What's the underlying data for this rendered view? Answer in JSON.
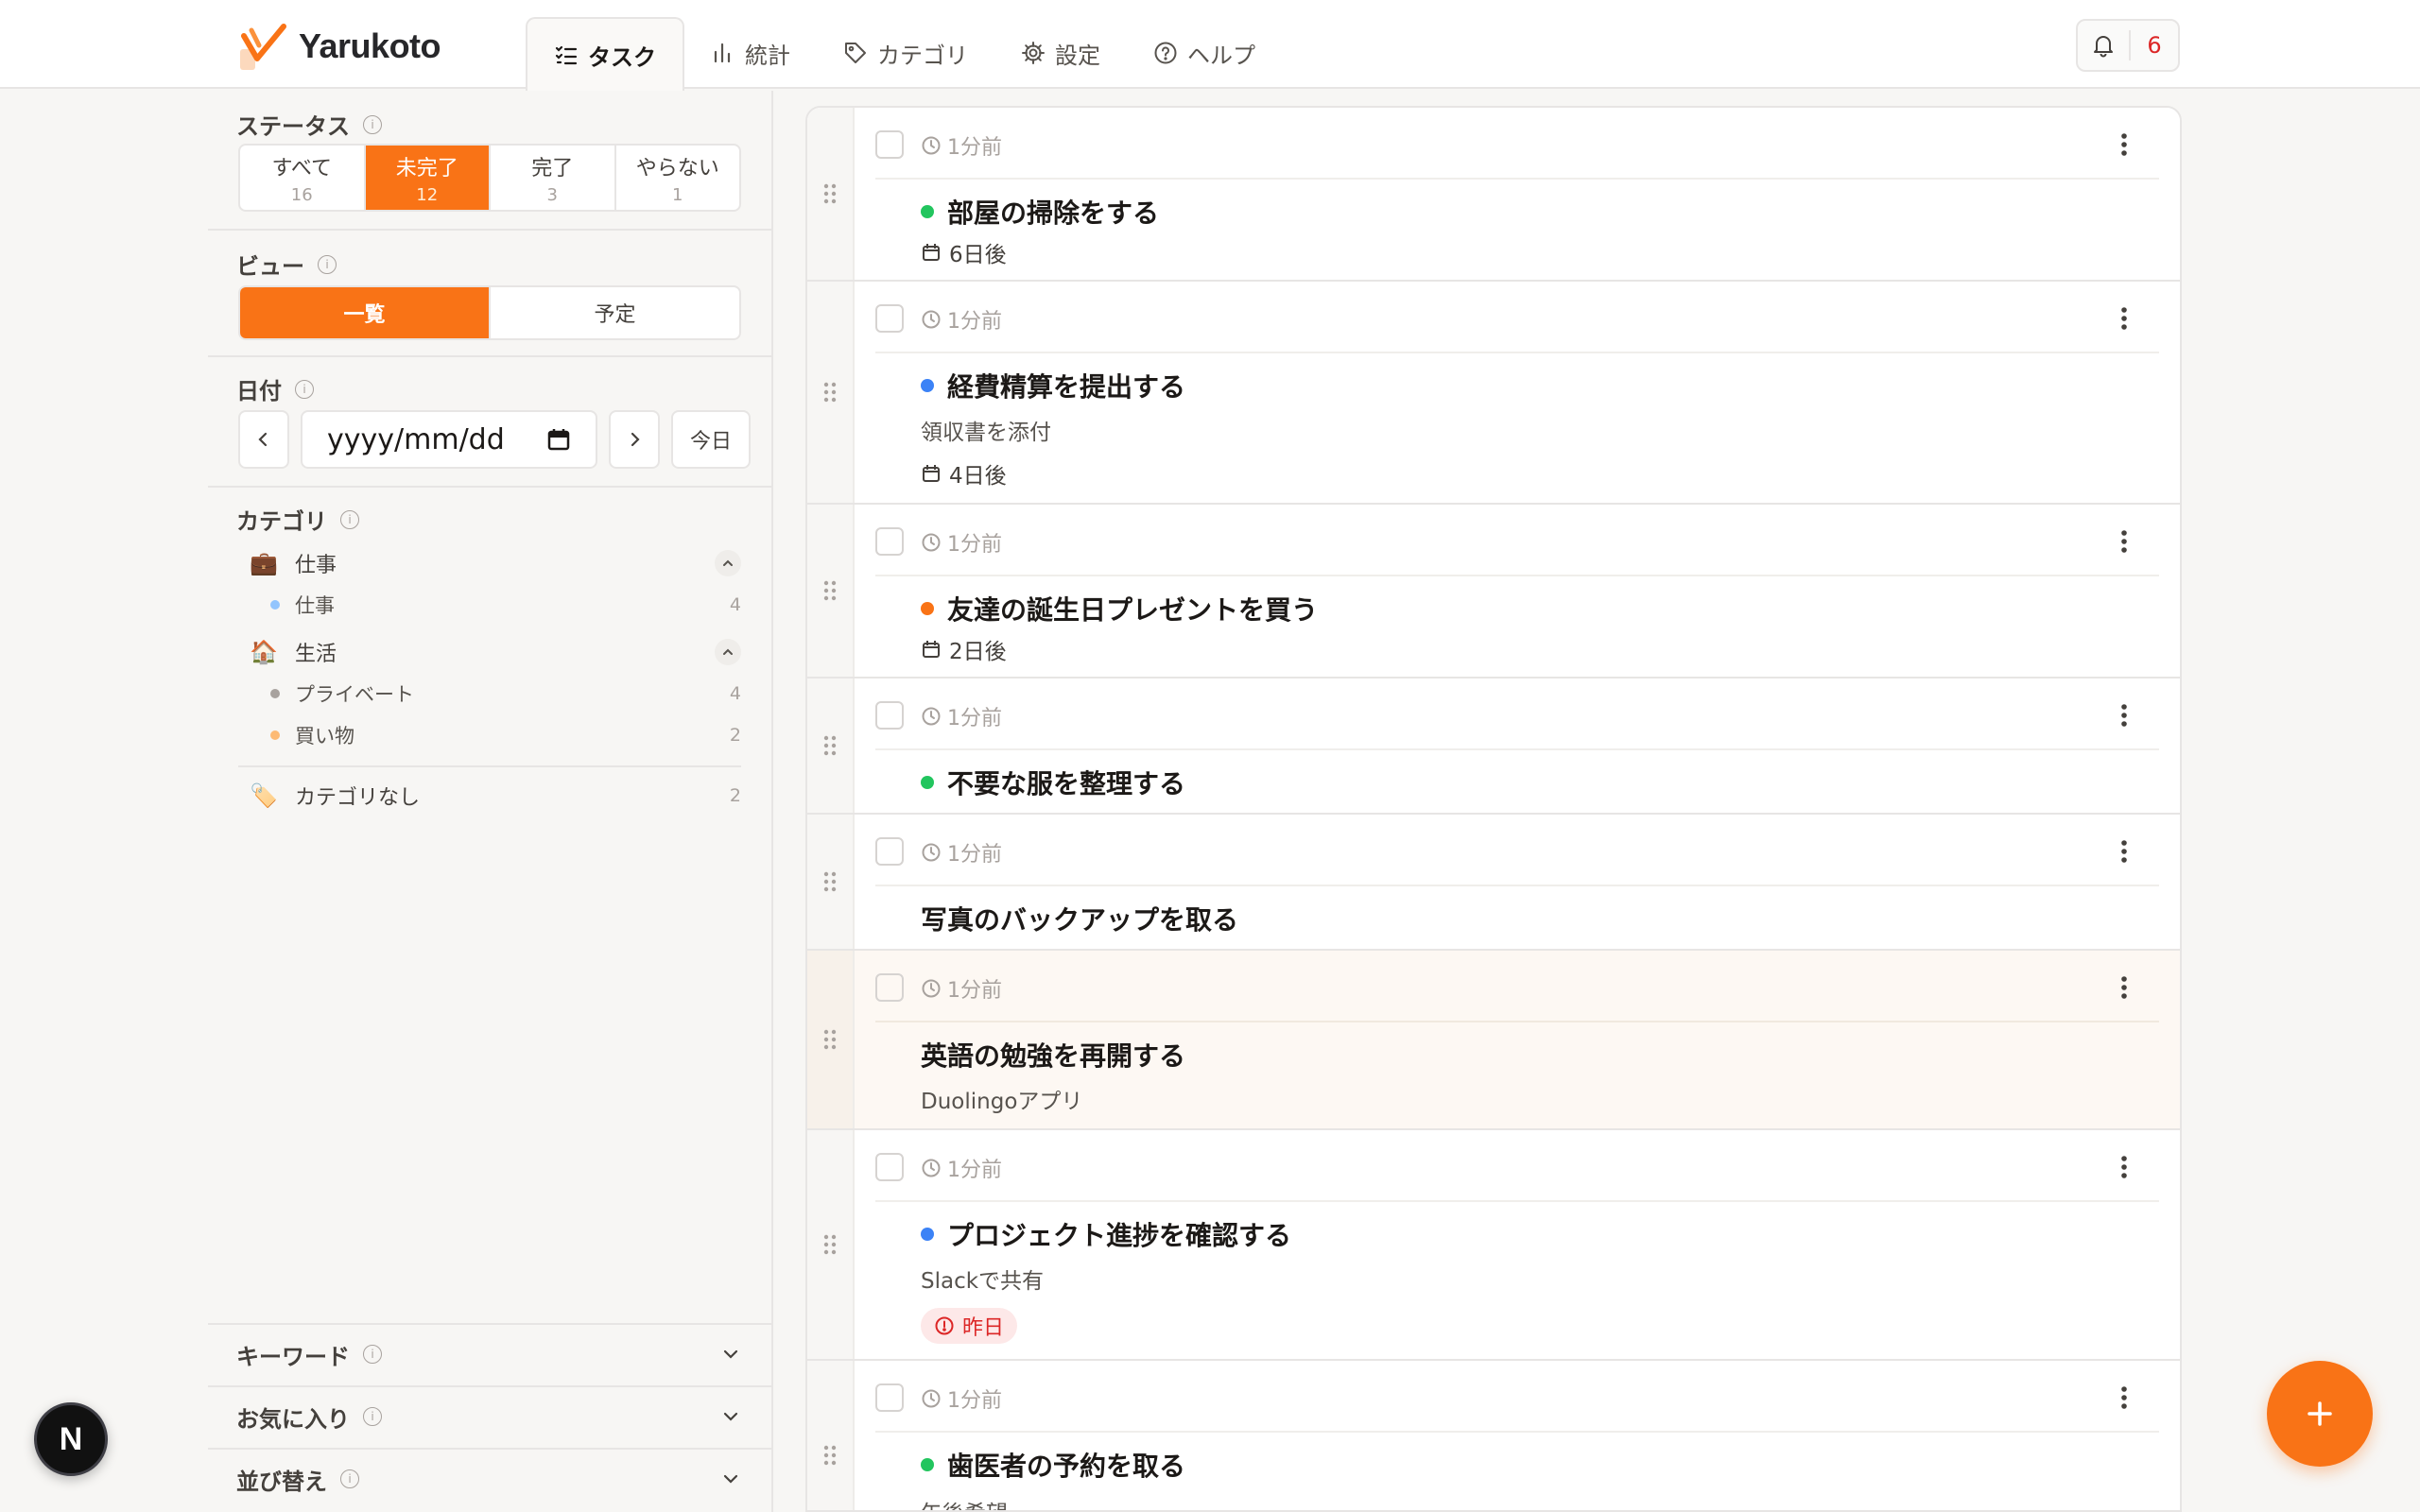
{
  "app": {
    "name": "Yarukoto"
  },
  "nav": {
    "tabs": [
      {
        "label": "タスク",
        "icon": "list-check-icon",
        "active": true
      },
      {
        "label": "統計",
        "icon": "bar-chart-icon"
      },
      {
        "label": "カテゴリ",
        "icon": "tag-icon"
      },
      {
        "label": "設定",
        "icon": "gear-icon"
      },
      {
        "label": "ヘルプ",
        "icon": "help-circle-icon"
      }
    ],
    "notifications": {
      "icon": "bell-icon",
      "count": "6"
    }
  },
  "sidebar": {
    "status": {
      "title": "ステータス",
      "options": [
        {
          "label": "すべて",
          "count": "16"
        },
        {
          "label": "未完了",
          "count": "12",
          "active": true
        },
        {
          "label": "完了",
          "count": "3"
        },
        {
          "label": "やらない",
          "count": "1"
        }
      ]
    },
    "view": {
      "title": "ビュー",
      "options": [
        {
          "label": "一覧",
          "active": true
        },
        {
          "label": "予定"
        }
      ]
    },
    "date": {
      "title": "日付",
      "placeholder": "yyyy/mm/dd",
      "today_label": "今日"
    },
    "category": {
      "title": "カテゴリ",
      "groups": [
        {
          "label": "仕事",
          "emoji": "💼",
          "children": [
            {
              "label": "仕事",
              "count": "4",
              "color": "#93c5fd"
            }
          ]
        },
        {
          "label": "生活",
          "emoji": "🏠",
          "children": [
            {
              "label": "プライベート",
              "count": "4",
              "color": "#a8a29e"
            },
            {
              "label": "買い物",
              "count": "2",
              "color": "#fdba74"
            }
          ]
        }
      ],
      "none": {
        "label": "カテゴリなし",
        "emoji": "🏷️",
        "count": "2"
      }
    },
    "keyword": {
      "title": "キーワード"
    },
    "favorites": {
      "title": "お気に入り"
    },
    "sort": {
      "title": "並び替え"
    }
  },
  "tasks": [
    {
      "ago": "1分前",
      "title": "部屋の掃除をする",
      "dot": "#22c55e",
      "due": "6日後"
    },
    {
      "ago": "1分前",
      "title": "経費精算を提出する",
      "dot": "#3b82f6",
      "memo": "領収書を添付",
      "due": "4日後"
    },
    {
      "ago": "1分前",
      "title": "友達の誕生日プレゼントを買う",
      "dot": "#f97316",
      "due": "2日後"
    },
    {
      "ago": "1分前",
      "title": "不要な服を整理する",
      "dot": "#22c55e"
    },
    {
      "ago": "1分前",
      "title": "写真のバックアップを取る"
    },
    {
      "ago": "1分前",
      "title": "英語の勉強を再開する",
      "memo": "Duolingoアプリ",
      "highlight": true
    },
    {
      "ago": "1分前",
      "title": "プロジェクト進捗を確認する",
      "dot": "#3b82f6",
      "memo": "Slackで共有",
      "overdue": "昨日"
    },
    {
      "ago": "1分前",
      "title": "歯医者の予約を取る",
      "dot": "#22c55e",
      "memo": "午後希望"
    }
  ],
  "colors": {
    "accent": "#f97316",
    "overdue_bg": "#fde8e8",
    "overdue_text": "#dc2626"
  }
}
